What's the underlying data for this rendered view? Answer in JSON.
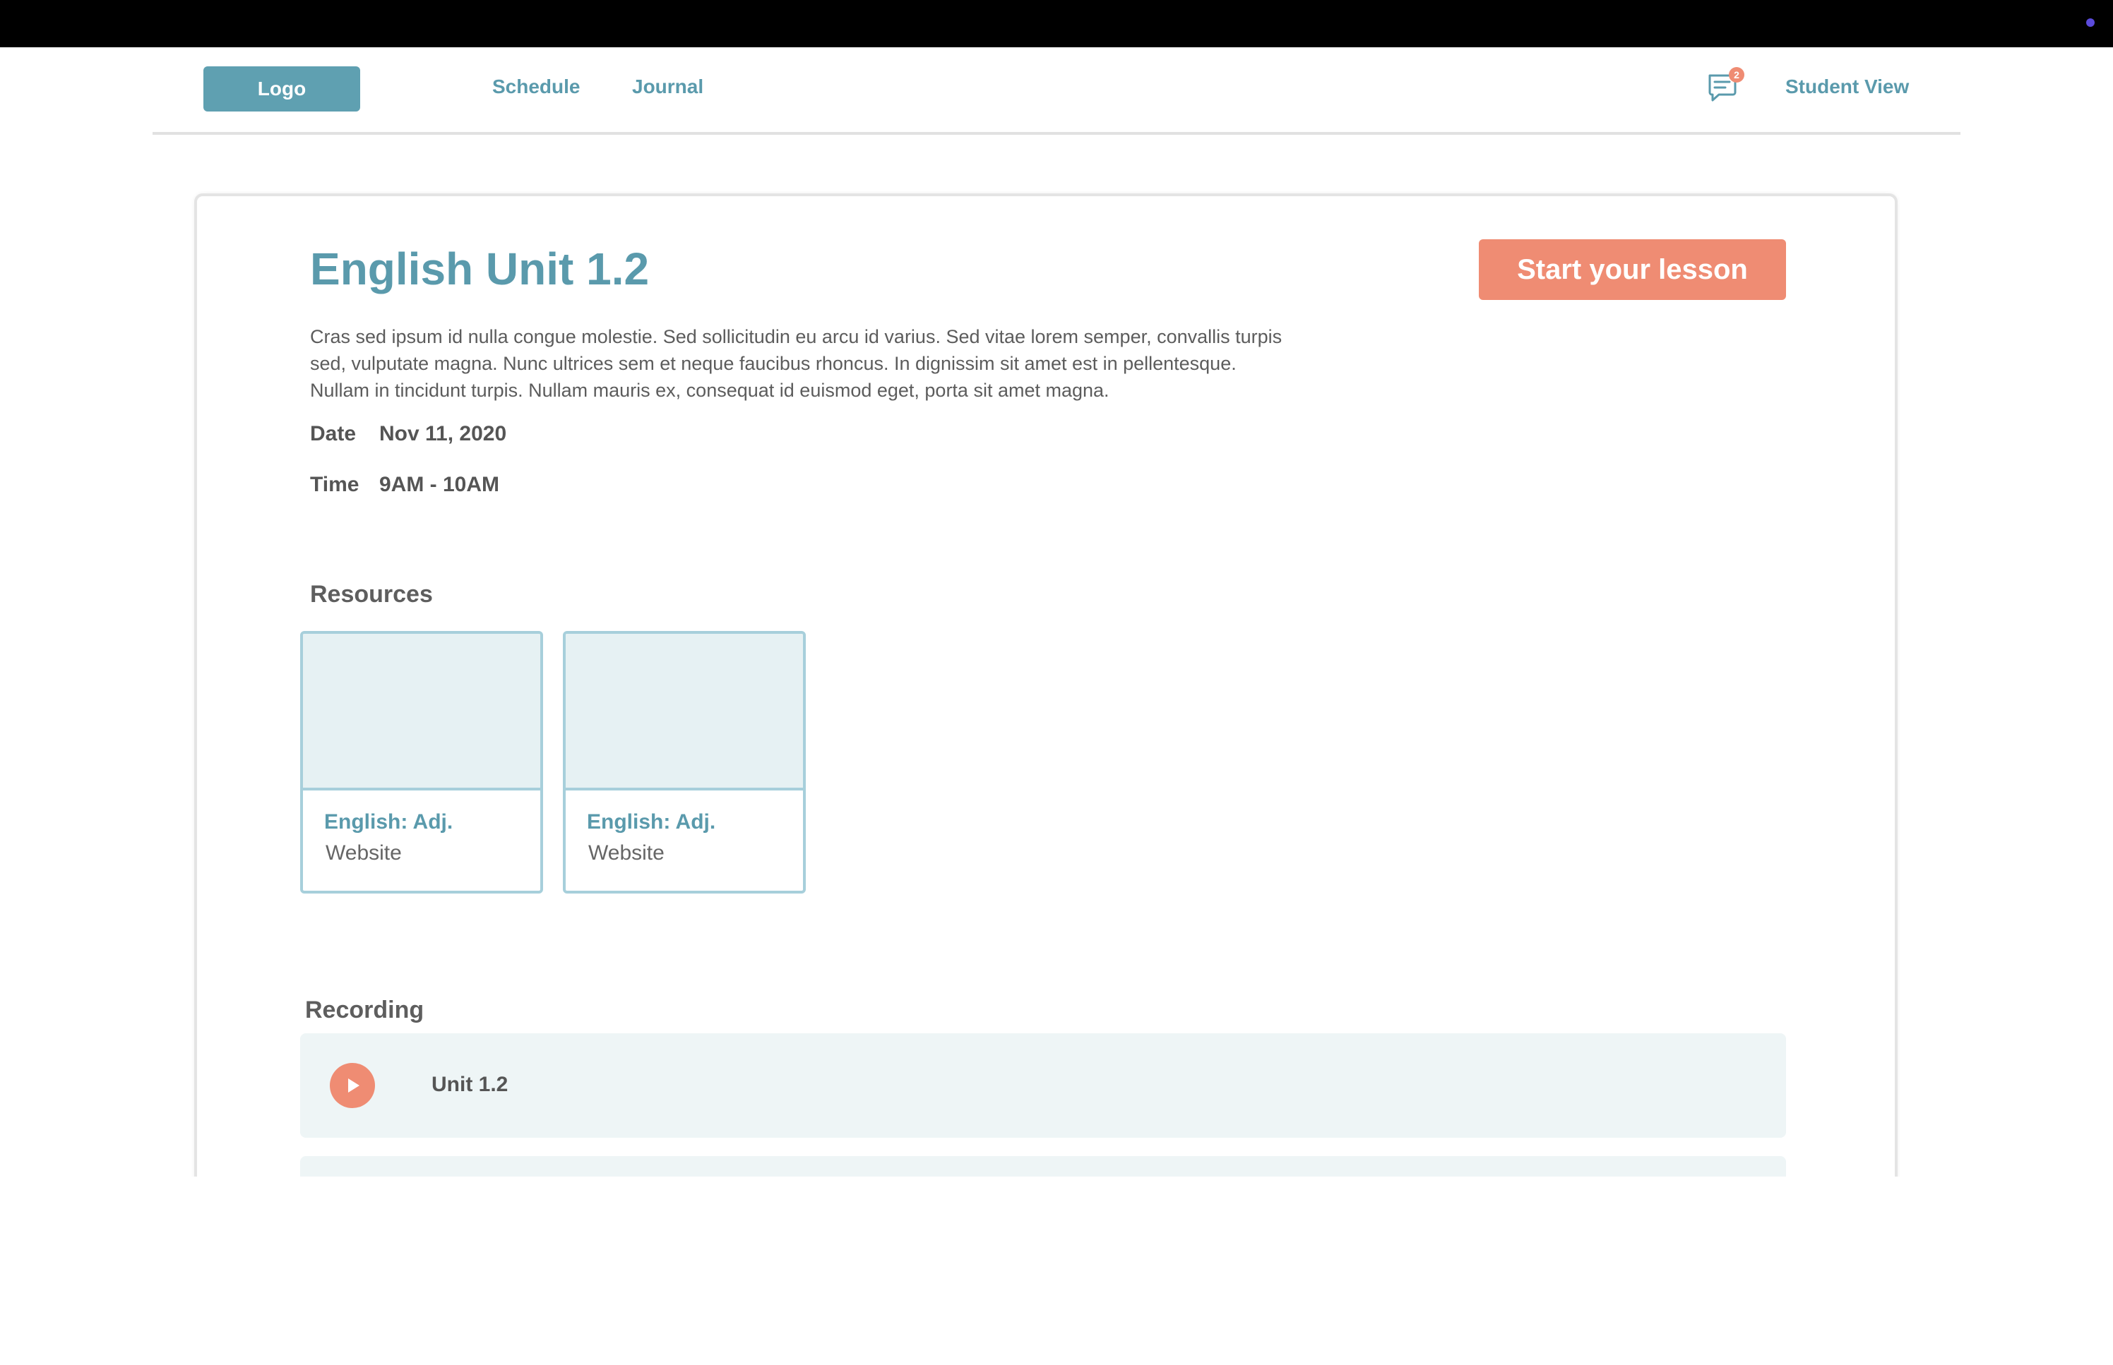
{
  "nav": {
    "logo_label": "Logo",
    "links": [
      "Schedule",
      "Journal"
    ],
    "messages_badge": "2",
    "messages_icon": "chat-icon",
    "student_view_label": "Student View"
  },
  "lesson": {
    "title": "English Unit 1.2",
    "start_button_label": "Start your lesson",
    "description": "Cras sed ipsum id nulla congue molestie. Sed sollicitudin eu arcu id varius. Sed vitae lorem semper, convallis turpis sed, vulputate magna. Nunc ultrices sem et neque faucibus rhoncus. In dignissim sit amet est in pellentesque. Nullam in tincidunt turpis. Nullam mauris ex, consequat id euismod eget, porta sit amet magna.",
    "date_label": "Date",
    "date_value": "Nov 11, 2020",
    "time_label": "Time",
    "time_value": "9AM - 10AM"
  },
  "resources": {
    "heading": "Resources",
    "items": [
      {
        "title": "English:  Adj.",
        "type": "Website"
      },
      {
        "title": "English:  Adj.",
        "type": "Website"
      }
    ]
  },
  "recording": {
    "heading": "Recording",
    "items": [
      {
        "label": "Unit 1.2",
        "icon": "play-icon"
      }
    ]
  },
  "colors": {
    "accent": "#5a9aac",
    "cta": "#ef8c73",
    "resource_thumb": "#e6f1f3",
    "recording_bg": "#eef5f6"
  }
}
